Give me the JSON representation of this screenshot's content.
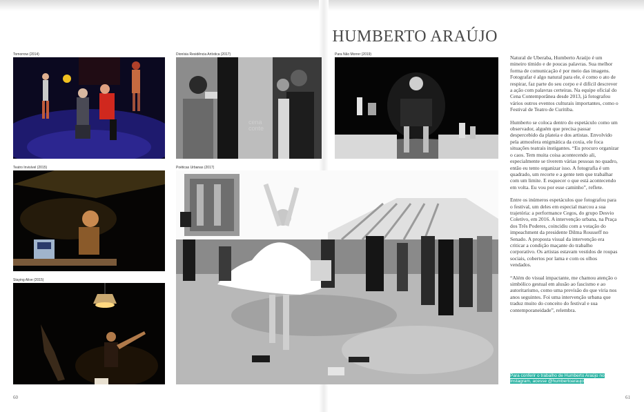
{
  "header": {
    "title": "HUMBERTO ARAÚJO"
  },
  "captions": {
    "tomorrow": "Tomorrow (2014)",
    "dionisia": "Dionísia Residência Artística (2017)",
    "para_nao_morrer": "Para Não Morrer (2019)",
    "teatro_invisivel": "Teatro Invisível (2015)",
    "poeticas_urbanas": "Poéticas Urbanas (2017)",
    "staying_alive": "Staying Alive (2015)"
  },
  "photo_text": {
    "cena_line1": "cena",
    "cena_line2": "conte"
  },
  "article": {
    "paragraphs": [
      "Natural de Uberaba, Humberto Araújo é um mineiro tímido e de poucas palavras. Sua melhor forma de comunicação é por meio das imagens. Fotografar é algo natural para ele, é como o ato de respirar, faz parte do seu corpo e é difícil descrever a ação com palavras certeiras. Na equipe oficial do Cena Contemporânea desde 2013, já fotografou vários outros eventos culturais importantes, como o Festival de Teatro de Curitiba.",
      "Humberto se coloca dentro do espetáculo como um observador, alguém que precisa passar despercebido da plateia e dos artistas. Envolvido pela atmosfera enigmática da coxia, ele foca situações teatrais instigantes. “Eu procuro organizar o caos. Tem muita coisa acontecendo ali, especialmente se tiverem várias pessoas no quadro, então eu tento organizar isso. A fotografia é um quadrado, um recorte e a gente tem que trabalhar com um limite. E esquecer o que está acontecendo em volta. Eu vou por esse caminho”, reflete.",
      "Entre os inúmeros espetáculos que fotografou para o festival, um deles em especial marcou a sua trajetória: a performance Cegos, do grupo Desvio Coletivo, em 2016. A intervenção urbana, na Praça dos Três Poderes, coincidiu com a votação do impeachment da presidente Dilma Rousseff no Senado. A proposta visual da intervenção era criticar a condição maçante do trabalho corporativo. Os artistas estavam vestidos de roupas sociais, cobertos por lama e com os olhos vendados.",
      "“Além do visual impactante, me chamou atenção o simbólico gestual em alusão ao fascismo e ao autoritarismo, como uma previsão do que viria nos anos seguintes. Foi uma intervenção urbana que traduz muito do conceito do festival e sua contemporaneidade”, relembra."
    ],
    "highlight": "Para conferir o trabalho de Humberto Araújo no Instagram, acesse @humbertoaraujo"
  },
  "pages": {
    "left": "60",
    "right": "61"
  },
  "colors": {
    "highlight": "#2bb3a3",
    "title": "#4a4a4a"
  }
}
